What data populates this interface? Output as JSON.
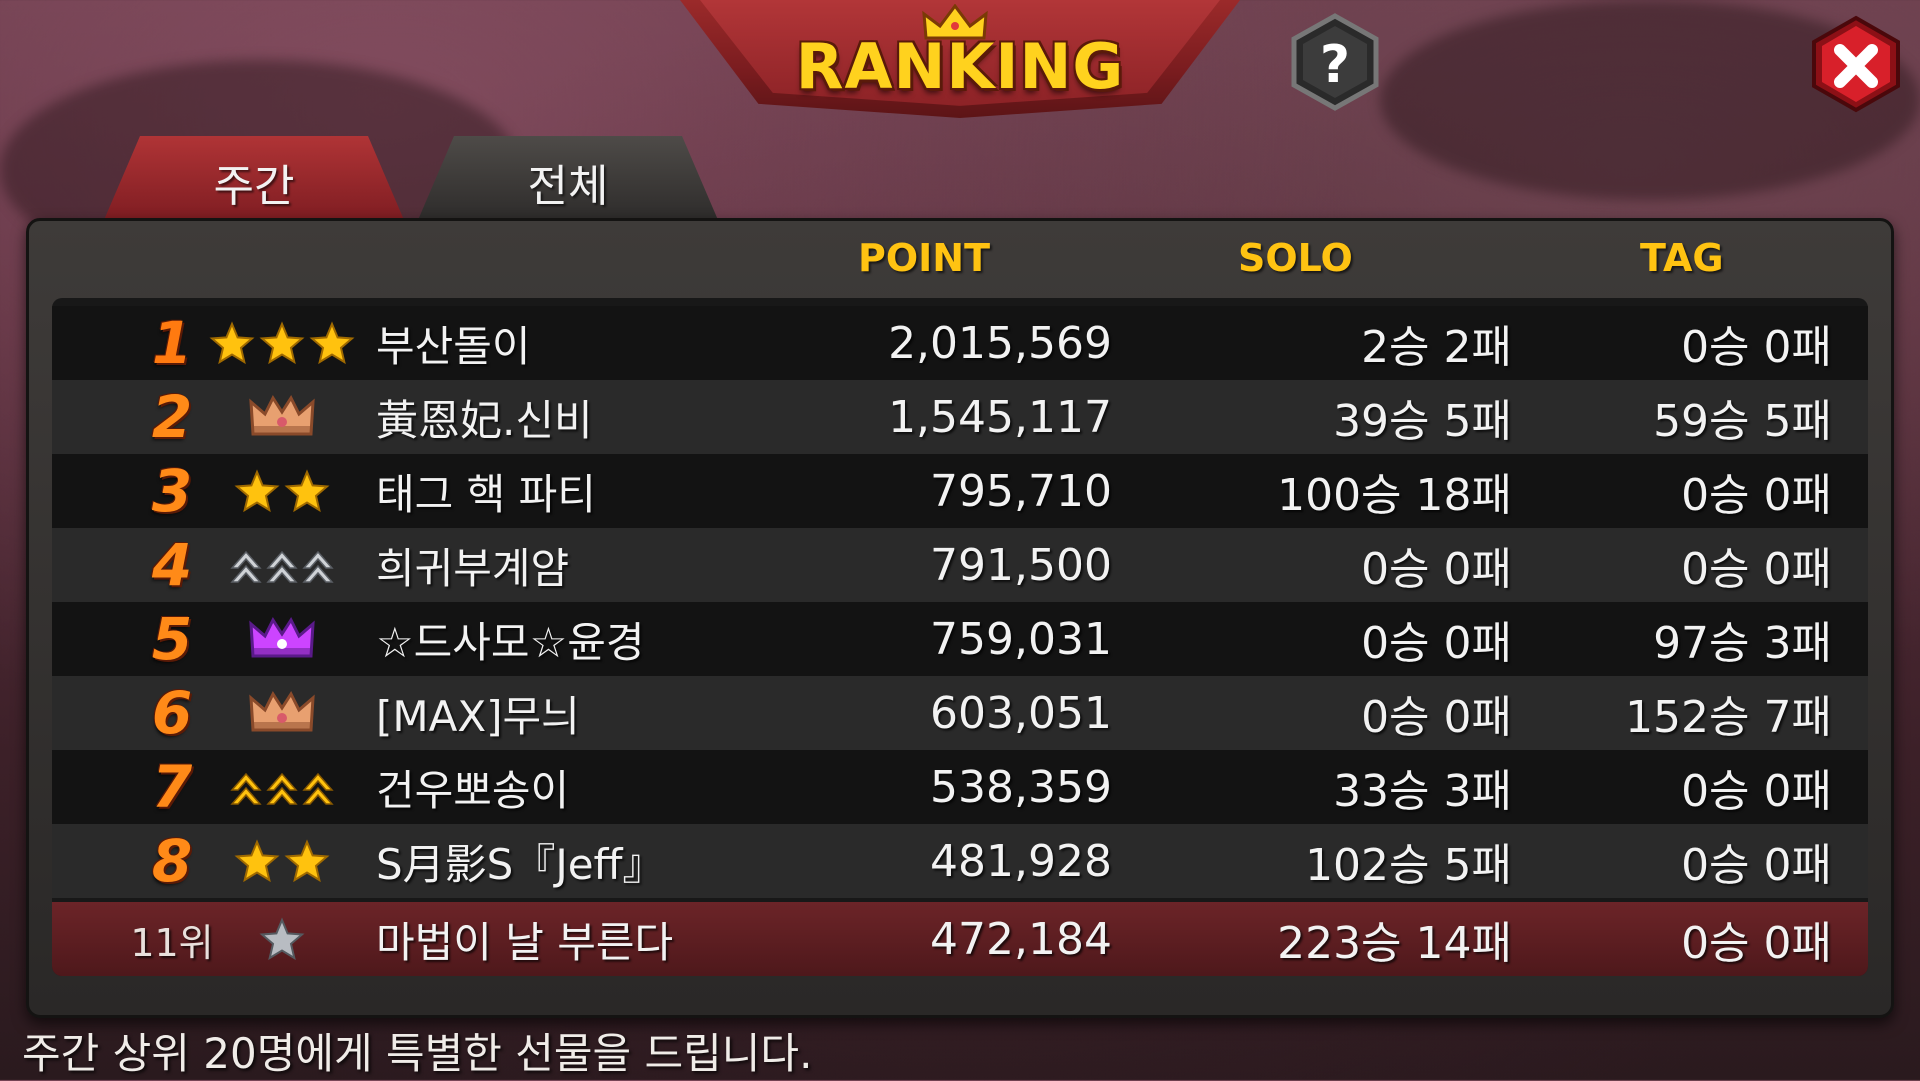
{
  "title": "RANKING",
  "tabs": {
    "weekly": "주간",
    "all": "전체",
    "active": "weekly"
  },
  "columns": {
    "point": "POINT",
    "solo": "SOLO",
    "tag": "TAG"
  },
  "rows": [
    {
      "rank": "1",
      "badge": "gold-star-3-icon",
      "name": "부산돌이",
      "point": "2,015,569",
      "solo": "2승 2패",
      "tag": "0승 0패"
    },
    {
      "rank": "2",
      "badge": "bronze-crown-icon",
      "name": "黃恩妃.신비",
      "point": "1,545,117",
      "solo": "39승 5패",
      "tag": "59승 5패"
    },
    {
      "rank": "3",
      "badge": "gold-star-2-icon",
      "name": "태그 핵 파티",
      "point": "795,710",
      "solo": "100승 18패",
      "tag": "0승 0패"
    },
    {
      "rank": "4",
      "badge": "silver-chevron-3-icon",
      "name": "희귀부계얌",
      "point": "791,500",
      "solo": "0승 0패",
      "tag": "0승 0패"
    },
    {
      "rank": "5",
      "badge": "purple-crown-icon",
      "name": "☆드사모☆윤경",
      "point": "759,031",
      "solo": "0승 0패",
      "tag": "97승 3패"
    },
    {
      "rank": "6",
      "badge": "bronze-crown-icon",
      "name": "[MAX]무늬",
      "point": "603,051",
      "solo": "0승 0패",
      "tag": "152승 7패"
    },
    {
      "rank": "7",
      "badge": "gold-chevron-3-icon",
      "name": "건우뽀송이",
      "point": "538,359",
      "solo": "33승 3패",
      "tag": "0승 0패"
    },
    {
      "rank": "8",
      "badge": "gold-star-2-icon",
      "name": "S月影S『Jeff』",
      "point": "481,928",
      "solo": "102승 5패",
      "tag": "0승 0패"
    }
  ],
  "my_row": {
    "rank": "11위",
    "badge": "silver-star-icon",
    "name": "마법이 날 부른다",
    "point": "472,184",
    "solo": "223승 14패",
    "tag": "0승 0패"
  },
  "footer": "주간 상위 20명에게 특별한 선물을 드립니다.",
  "colors": {
    "accent_gold": "#ffc312",
    "rank_orange": "#ff8a18",
    "tab_red": "#b03436",
    "close_red": "#d8202a"
  },
  "icons": {
    "help": "question-mark-icon",
    "close": "close-x-icon",
    "title_crown": "crown-icon"
  }
}
